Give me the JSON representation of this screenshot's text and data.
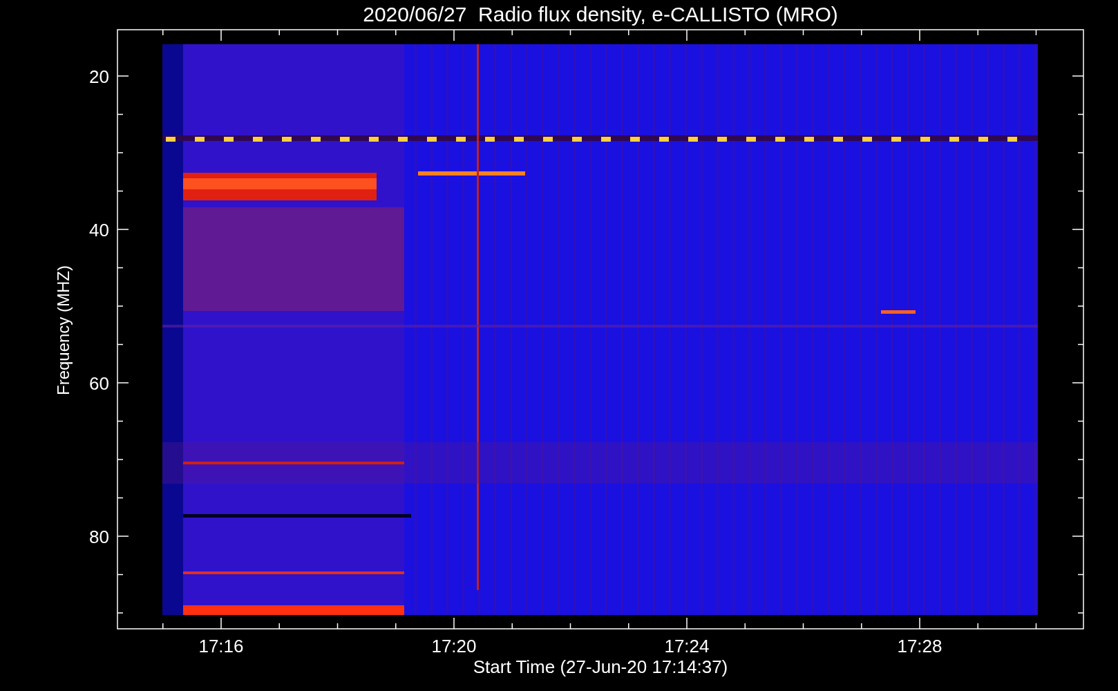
{
  "title": "2020/06/27  Radio flux density, e-CALLISTO (MRO)",
  "y_axis": {
    "label": "Frequency (MHZ)",
    "ticks": [
      "20",
      "40",
      "60",
      "80"
    ]
  },
  "x_axis": {
    "label": "Start Time (27-Jun-20 17:14:37)",
    "ticks": [
      "17:16",
      "17:20",
      "17:24",
      "17:28"
    ]
  }
}
